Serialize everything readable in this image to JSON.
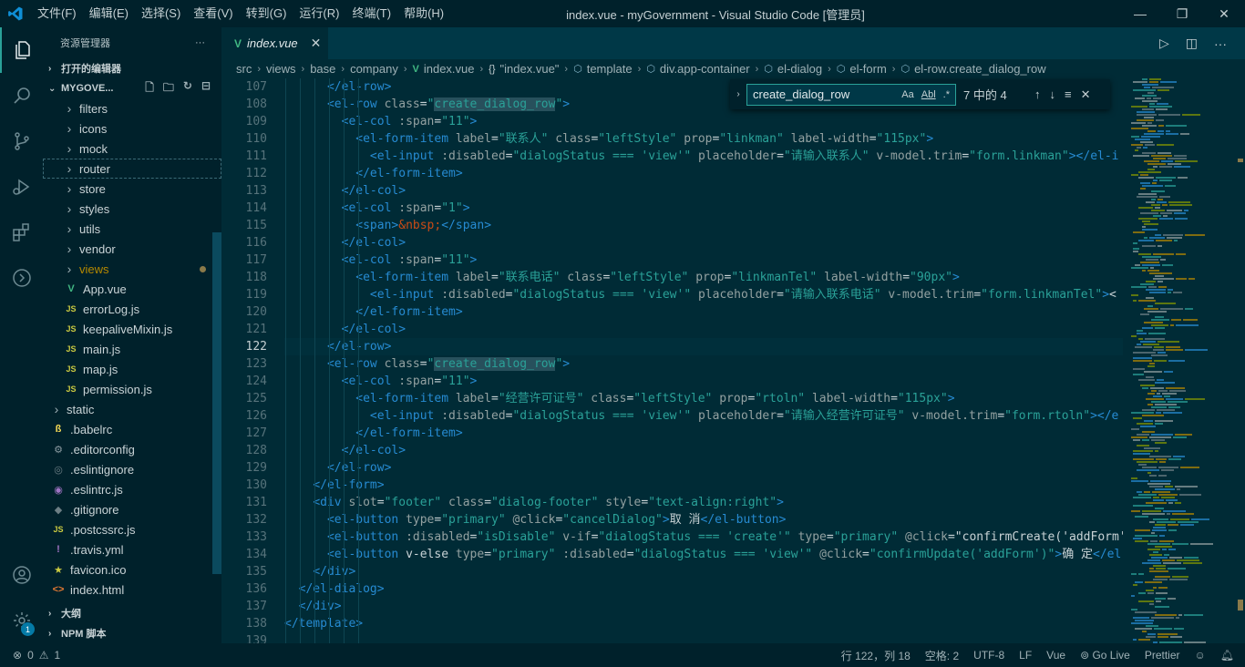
{
  "titlebar": {
    "menus": [
      "文件(F)",
      "编辑(E)",
      "选择(S)",
      "查看(V)",
      "转到(G)",
      "运行(R)",
      "终端(T)",
      "帮助(H)"
    ],
    "title": "index.vue - myGovernment - Visual Studio Code [管理员]",
    "minimize": "—",
    "maximize": "❐",
    "close": "✕"
  },
  "sidebar": {
    "title": "资源管理器",
    "more": "···",
    "open_editors": "打开的编辑器",
    "project": "MYGOVE...",
    "outline": "大纲",
    "npm": "NPM 脚本",
    "items": [
      {
        "label": "filters",
        "type": "folder",
        "indent": 1
      },
      {
        "label": "icons",
        "type": "folder",
        "indent": 1
      },
      {
        "label": "mock",
        "type": "folder",
        "indent": 1
      },
      {
        "label": "router",
        "type": "folder",
        "indent": 1
      },
      {
        "label": "store",
        "type": "folder",
        "indent": 1
      },
      {
        "label": "styles",
        "type": "folder",
        "indent": 1
      },
      {
        "label": "utils",
        "type": "folder",
        "indent": 1
      },
      {
        "label": "vendor",
        "type": "folder",
        "indent": 1
      },
      {
        "label": "views",
        "type": "folder",
        "indent": 1
      },
      {
        "label": "App.vue",
        "type": "vue",
        "indent": 1
      },
      {
        "label": "errorLog.js",
        "type": "js",
        "indent": 1
      },
      {
        "label": "keepaliveMixin.js",
        "type": "js",
        "indent": 1
      },
      {
        "label": "main.js",
        "type": "js",
        "indent": 1
      },
      {
        "label": "map.js",
        "type": "js",
        "indent": 1
      },
      {
        "label": "permission.js",
        "type": "js",
        "indent": 1
      },
      {
        "label": "static",
        "type": "folder",
        "indent": 0
      },
      {
        "label": ".babelrc",
        "type": "babel",
        "indent": 0
      },
      {
        "label": ".editorconfig",
        "type": "gear",
        "indent": 0
      },
      {
        "label": ".eslintignore",
        "type": "eslint",
        "indent": 0
      },
      {
        "label": ".eslintrc.js",
        "type": "eslintrc",
        "indent": 0
      },
      {
        "label": ".gitignore",
        "type": "git",
        "indent": 0
      },
      {
        "label": ".postcssrc.js",
        "type": "js",
        "indent": 0
      },
      {
        "label": ".travis.yml",
        "type": "yml",
        "indent": 0
      },
      {
        "label": "favicon.ico",
        "type": "star",
        "indent": 0
      },
      {
        "label": "index.html",
        "type": "html",
        "indent": 0
      }
    ]
  },
  "tab": {
    "label": "index.vue",
    "icon": "V",
    "close": "✕"
  },
  "breadcrumb": [
    "src",
    "views",
    "base",
    "company",
    "index.vue",
    "\"index.vue\"",
    "template",
    "div.app-container",
    "el-dialog",
    "el-form",
    "el-row.create_dialog_row"
  ],
  "find": {
    "query": "create_dialog_row",
    "count": "7 中的 4",
    "opt_case": "Aa",
    "opt_word": "Abl",
    "opt_regex": ".*"
  },
  "editor": {
    "line_numbers": [
      "107",
      "108",
      "109",
      "110",
      "111",
      "112",
      "113",
      "114",
      "115",
      "116",
      "117",
      "118",
      "119",
      "120",
      "121",
      "122",
      "123",
      "124",
      "125",
      "126",
      "127",
      "128",
      "129",
      "130",
      "131",
      "132",
      "133",
      "134",
      "135",
      "136",
      "137",
      "138",
      "139"
    ],
    "lines": [
      "      </el-row>",
      "      <el-row class=\"create_dialog_row\">",
      "        <el-col :span=\"11\">",
      "          <el-form-item label=\"联系人\" class=\"leftStyle\" prop=\"linkman\" label-width=\"115px\">",
      "            <el-input :disabled=\"dialogStatus === 'view'\" placeholder=\"请输入联系人\" v-model.trim=\"form.linkman\"></el-i",
      "          </el-form-item>",
      "        </el-col>",
      "        <el-col :span=\"1\">",
      "          <span>&nbsp;</span>",
      "        </el-col>",
      "        <el-col :span=\"11\">",
      "          <el-form-item label=\"联系电话\" class=\"leftStyle\" prop=\"linkmanTel\" label-width=\"90px\">",
      "            <el-input :disabled=\"dialogStatus === 'view'\" placeholder=\"请输入联系电话\" v-model.trim=\"form.linkmanTel\"><",
      "          </el-form-item>",
      "        </el-col>",
      "      </el-row>",
      "      <el-row class=\"create_dialog_row\">",
      "        <el-col :span=\"11\">",
      "          <el-form-item label=\"经营许可证号\" class=\"leftStyle\" prop=\"rtoln\" label-width=\"115px\">",
      "            <el-input :disabled=\"dialogStatus === 'view'\" placeholder=\"请输入经营许可证号\" v-model.trim=\"form.rtoln\"></e",
      "          </el-form-item>",
      "        </el-col>",
      "      </el-row>",
      "    </el-form>",
      "    <div slot=\"footer\" class=\"dialog-footer\" style=\"text-align:right\">",
      "      <el-button type=\"primary\" @click=\"cancelDialog\">取 消</el-button>",
      "      <el-button :disabled=\"isDisable\" v-if=\"dialogStatus === 'create'\" type=\"primary\" @click=\"confirmCreate('addForm'",
      "      <el-button v-else type=\"primary\" :disabled=\"dialogStatus === 'view'\" @click=\"confirmUpdate('addForm')\">确 定</el",
      "    </div>",
      "  </el-dialog>",
      "  </div>",
      "</template>",
      ""
    ],
    "current_line": "122"
  },
  "statusbar": {
    "errors": "0",
    "warnings": "1",
    "position": "行 122，列 18",
    "spaces": "空格: 2",
    "encoding": "UTF-8",
    "eol": "LF",
    "language": "Vue",
    "golive": "Go Live",
    "prettier": "Prettier"
  },
  "colors": {
    "background": "#002b36",
    "chrome": "#00212b",
    "accent": "#2aa198",
    "tag": "#268bd2",
    "string": "#2aa198"
  }
}
